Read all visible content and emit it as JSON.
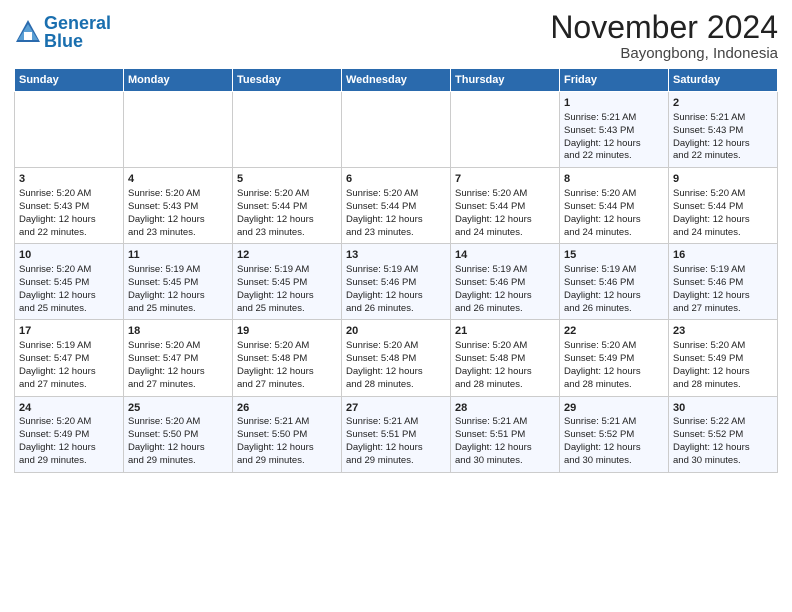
{
  "header": {
    "logo_line1": "General",
    "logo_line2": "Blue",
    "month": "November 2024",
    "location": "Bayongbong, Indonesia"
  },
  "weekdays": [
    "Sunday",
    "Monday",
    "Tuesday",
    "Wednesday",
    "Thursday",
    "Friday",
    "Saturday"
  ],
  "weeks": [
    [
      {
        "day": "",
        "info": ""
      },
      {
        "day": "",
        "info": ""
      },
      {
        "day": "",
        "info": ""
      },
      {
        "day": "",
        "info": ""
      },
      {
        "day": "",
        "info": ""
      },
      {
        "day": "1",
        "info": "Sunrise: 5:21 AM\nSunset: 5:43 PM\nDaylight: 12 hours\nand 22 minutes."
      },
      {
        "day": "2",
        "info": "Sunrise: 5:21 AM\nSunset: 5:43 PM\nDaylight: 12 hours\nand 22 minutes."
      }
    ],
    [
      {
        "day": "3",
        "info": "Sunrise: 5:20 AM\nSunset: 5:43 PM\nDaylight: 12 hours\nand 22 minutes."
      },
      {
        "day": "4",
        "info": "Sunrise: 5:20 AM\nSunset: 5:43 PM\nDaylight: 12 hours\nand 23 minutes."
      },
      {
        "day": "5",
        "info": "Sunrise: 5:20 AM\nSunset: 5:44 PM\nDaylight: 12 hours\nand 23 minutes."
      },
      {
        "day": "6",
        "info": "Sunrise: 5:20 AM\nSunset: 5:44 PM\nDaylight: 12 hours\nand 23 minutes."
      },
      {
        "day": "7",
        "info": "Sunrise: 5:20 AM\nSunset: 5:44 PM\nDaylight: 12 hours\nand 24 minutes."
      },
      {
        "day": "8",
        "info": "Sunrise: 5:20 AM\nSunset: 5:44 PM\nDaylight: 12 hours\nand 24 minutes."
      },
      {
        "day": "9",
        "info": "Sunrise: 5:20 AM\nSunset: 5:44 PM\nDaylight: 12 hours\nand 24 minutes."
      }
    ],
    [
      {
        "day": "10",
        "info": "Sunrise: 5:20 AM\nSunset: 5:45 PM\nDaylight: 12 hours\nand 25 minutes."
      },
      {
        "day": "11",
        "info": "Sunrise: 5:19 AM\nSunset: 5:45 PM\nDaylight: 12 hours\nand 25 minutes."
      },
      {
        "day": "12",
        "info": "Sunrise: 5:19 AM\nSunset: 5:45 PM\nDaylight: 12 hours\nand 25 minutes."
      },
      {
        "day": "13",
        "info": "Sunrise: 5:19 AM\nSunset: 5:46 PM\nDaylight: 12 hours\nand 26 minutes."
      },
      {
        "day": "14",
        "info": "Sunrise: 5:19 AM\nSunset: 5:46 PM\nDaylight: 12 hours\nand 26 minutes."
      },
      {
        "day": "15",
        "info": "Sunrise: 5:19 AM\nSunset: 5:46 PM\nDaylight: 12 hours\nand 26 minutes."
      },
      {
        "day": "16",
        "info": "Sunrise: 5:19 AM\nSunset: 5:46 PM\nDaylight: 12 hours\nand 27 minutes."
      }
    ],
    [
      {
        "day": "17",
        "info": "Sunrise: 5:19 AM\nSunset: 5:47 PM\nDaylight: 12 hours\nand 27 minutes."
      },
      {
        "day": "18",
        "info": "Sunrise: 5:20 AM\nSunset: 5:47 PM\nDaylight: 12 hours\nand 27 minutes."
      },
      {
        "day": "19",
        "info": "Sunrise: 5:20 AM\nSunset: 5:48 PM\nDaylight: 12 hours\nand 27 minutes."
      },
      {
        "day": "20",
        "info": "Sunrise: 5:20 AM\nSunset: 5:48 PM\nDaylight: 12 hours\nand 28 minutes."
      },
      {
        "day": "21",
        "info": "Sunrise: 5:20 AM\nSunset: 5:48 PM\nDaylight: 12 hours\nand 28 minutes."
      },
      {
        "day": "22",
        "info": "Sunrise: 5:20 AM\nSunset: 5:49 PM\nDaylight: 12 hours\nand 28 minutes."
      },
      {
        "day": "23",
        "info": "Sunrise: 5:20 AM\nSunset: 5:49 PM\nDaylight: 12 hours\nand 28 minutes."
      }
    ],
    [
      {
        "day": "24",
        "info": "Sunrise: 5:20 AM\nSunset: 5:49 PM\nDaylight: 12 hours\nand 29 minutes."
      },
      {
        "day": "25",
        "info": "Sunrise: 5:20 AM\nSunset: 5:50 PM\nDaylight: 12 hours\nand 29 minutes."
      },
      {
        "day": "26",
        "info": "Sunrise: 5:21 AM\nSunset: 5:50 PM\nDaylight: 12 hours\nand 29 minutes."
      },
      {
        "day": "27",
        "info": "Sunrise: 5:21 AM\nSunset: 5:51 PM\nDaylight: 12 hours\nand 29 minutes."
      },
      {
        "day": "28",
        "info": "Sunrise: 5:21 AM\nSunset: 5:51 PM\nDaylight: 12 hours\nand 30 minutes."
      },
      {
        "day": "29",
        "info": "Sunrise: 5:21 AM\nSunset: 5:52 PM\nDaylight: 12 hours\nand 30 minutes."
      },
      {
        "day": "30",
        "info": "Sunrise: 5:22 AM\nSunset: 5:52 PM\nDaylight: 12 hours\nand 30 minutes."
      }
    ]
  ]
}
